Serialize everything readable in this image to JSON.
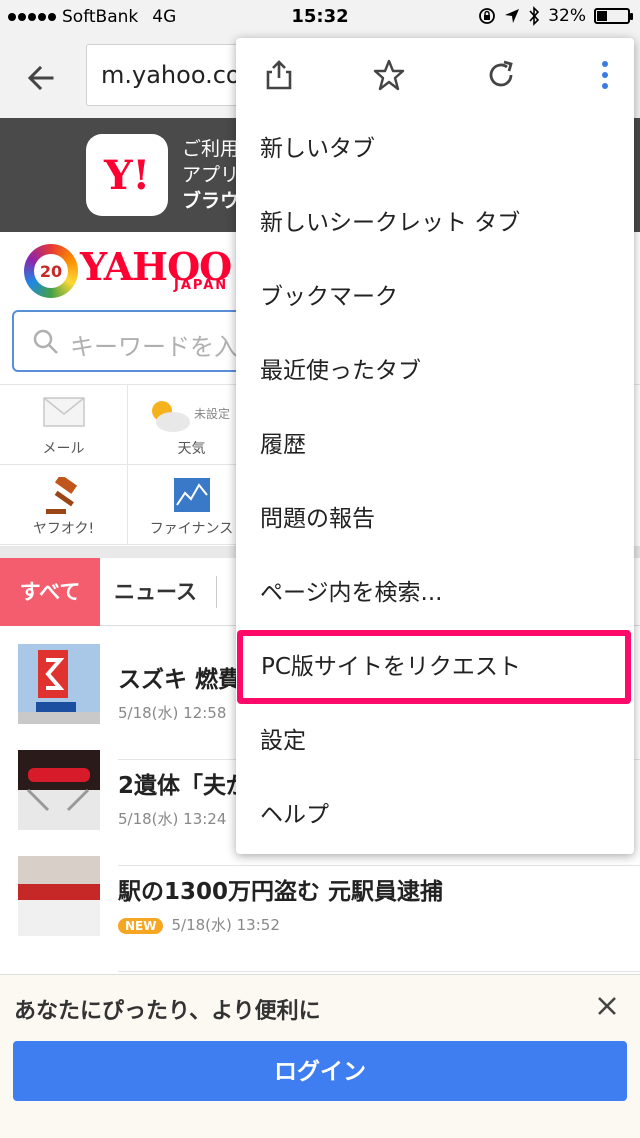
{
  "status_bar": {
    "carrier": "SoftBank",
    "network": "4G",
    "time": "15:32",
    "battery": "32%",
    "battery_level": 0.32
  },
  "browser": {
    "url": "m.yahoo.co.jp",
    "menu_actions": [
      "share-icon",
      "star-icon",
      "reload-icon",
      "more-vert-icon"
    ],
    "menu_items": [
      {
        "label": "新しいタブ"
      },
      {
        "label": "新しいシークレット タブ"
      },
      {
        "label": "ブックマーク"
      },
      {
        "label": "最近使ったタブ"
      },
      {
        "label": "履歴"
      },
      {
        "label": "問題の報告"
      },
      {
        "label": "ページ内を検索..."
      },
      {
        "label": "PC版サイトをリクエスト"
      },
      {
        "label": "設定"
      },
      {
        "label": "ヘルプ"
      }
    ],
    "highlight_color": "#ff0a6b"
  },
  "app_banner": {
    "icon_text": "Y!",
    "line1": "ご利用",
    "line2": "アプリ",
    "line3": "ブラウ"
  },
  "header": {
    "badge": "20",
    "logo": "YAHOO!",
    "logo_sub": "JAPAN",
    "search_placeholder": "キーワードを入"
  },
  "services": [
    {
      "label": "メール",
      "icon": "mail-icon"
    },
    {
      "label": "天気",
      "icon": "weather-icon",
      "extra": "未設定"
    },
    {
      "label": "ヤフオク!",
      "icon": "auction-hammer-icon"
    },
    {
      "label": "ファイナンス",
      "icon": "finance-chart-icon"
    }
  ],
  "tabs": {
    "all": "すべて",
    "news": "ニュース"
  },
  "news": [
    {
      "title": "スズキ 燃費",
      "time": "5/18(水) 12:58",
      "thumb": "suzuki-sign-thumb"
    },
    {
      "title": "2遺体「夫が",
      "time": "5/18(水) 13:24",
      "thumb": "police-car-thumb"
    },
    {
      "title": "駅の1300万円盗む 元駅員逮捕",
      "time": "5/18(水) 13:52",
      "badge": "NEW",
      "thumb": "police-light-thumb"
    }
  ],
  "login": {
    "message": "あなたにぴったり、より便利に",
    "button": "ログイン",
    "button_color": "#3f7ef0"
  }
}
